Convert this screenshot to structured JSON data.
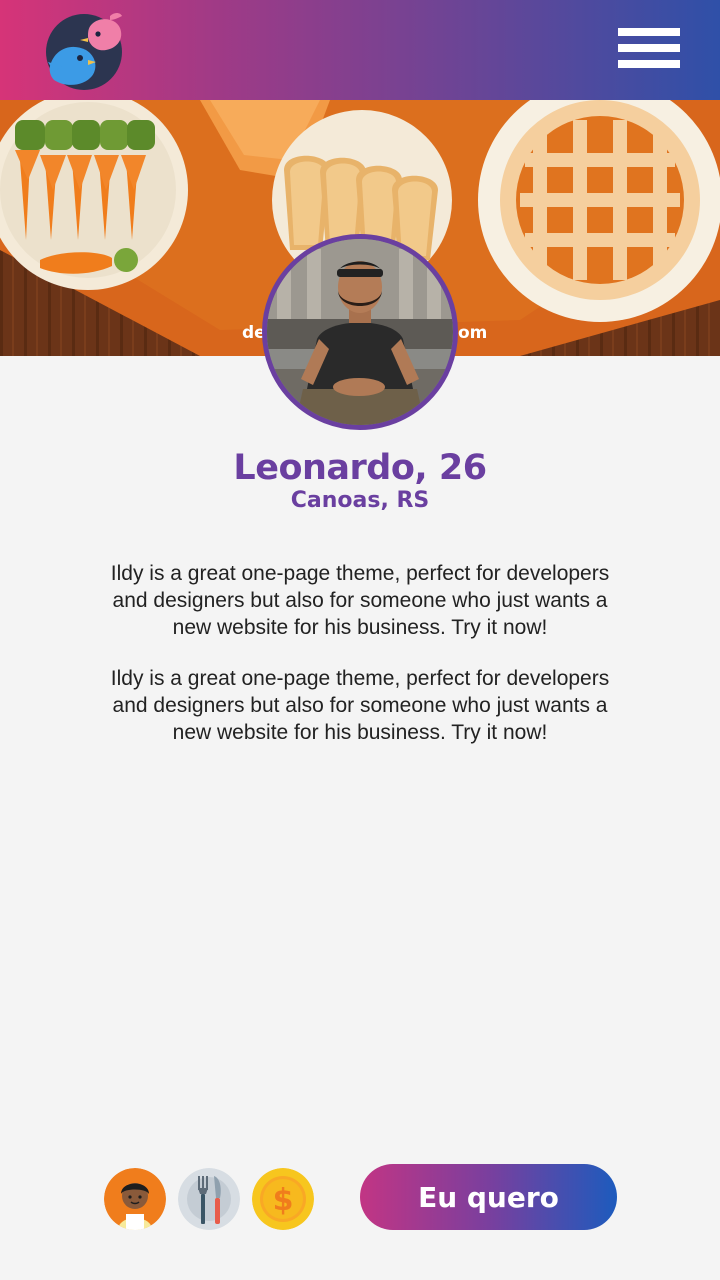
{
  "header": {
    "logo_icon": "birds-logo-icon",
    "menu_icon": "hamburger-menu-icon"
  },
  "cover": {
    "image": "food-cover-image",
    "watermark_left": "de",
    "watermark_right": "om"
  },
  "profile": {
    "name": "Leonardo, 26",
    "location": "Canoas, RS",
    "bio": [
      "Ildy is a great one-page theme, perfect for developers and designers but also for someone who just wants a new website for his business. Try it now!",
      "Ildy is a great one-page theme, perfect for developers and designers but also for someone who just wants a new website for his business. Try it now!"
    ]
  },
  "badges": [
    {
      "icon": "person-avatar-icon"
    },
    {
      "icon": "cutlery-icon"
    },
    {
      "icon": "dollar-coin-icon"
    }
  ],
  "cta": {
    "label": "Eu quero"
  },
  "colors": {
    "accent": "#6a3fa0",
    "gradient_start": "#d63478",
    "gradient_end": "#2f50a8",
    "cover_orange": "#d8661c"
  }
}
